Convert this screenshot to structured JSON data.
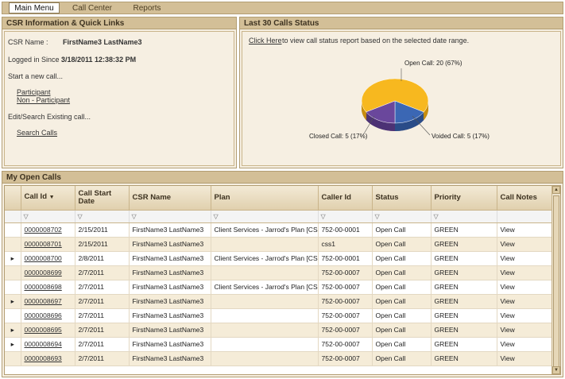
{
  "menu": {
    "items": [
      {
        "label": "Main Menu",
        "active": true
      },
      {
        "label": "Call Center",
        "active": false
      },
      {
        "label": "Reports",
        "active": false
      }
    ]
  },
  "csr_panel": {
    "title": "CSR Information & Quick Links",
    "csr_name_label": "CSR Name :",
    "csr_name_value": "FirstName3 LastName3",
    "logged_in_label": "Logged in Since :",
    "logged_in_value": "3/18/2011 12:38:32 PM",
    "start_new_call": "Start a new call...",
    "participant_link": "Participant",
    "non_participant_link": "Non - Participant",
    "edit_search_label": "Edit/Search Existing call...",
    "search_calls_link": "Search Calls"
  },
  "status_panel": {
    "title": "Last 30 Calls Status",
    "click_here": "Click Here",
    "description": " to view call status report based on the selected date range.",
    "colors": {
      "open": "#f7b81f",
      "closed": "#3b67b4",
      "voided": "#6a479c"
    }
  },
  "chart_data": {
    "type": "pie",
    "categories": [
      "Open Call",
      "Closed Call",
      "Voided Call"
    ],
    "values": [
      20,
      5,
      5
    ],
    "percents": [
      67,
      17,
      17
    ],
    "labels": [
      "Open Call: 20 (67%)",
      "Closed Call: 5 (17%)",
      "Voided Call: 5 (17%)"
    ]
  },
  "open_calls": {
    "title": "My Open Calls",
    "columns": [
      "Call Id",
      "Call Start Date",
      "CSR Name",
      "Plan",
      "Caller Id",
      "Status",
      "Priority",
      "Call Notes"
    ],
    "rows": [
      {
        "id": "0000008702",
        "date": "2/15/2011",
        "csr": "FirstName3 LastName3",
        "plan": "Client Services - Jarrod's Plan [CSS]",
        "caller": "752-00-0001",
        "status": "Open Call",
        "priority": "GREEN",
        "notes": "View",
        "expander": ""
      },
      {
        "id": "0000008701",
        "date": "2/15/2011",
        "csr": "FirstName3 LastName3",
        "plan": "",
        "caller": "css1",
        "status": "Open Call",
        "priority": "GREEN",
        "notes": "View",
        "expander": ""
      },
      {
        "id": "0000008700",
        "date": "2/8/2011",
        "csr": "FirstName3 LastName3",
        "plan": "Client Services - Jarrod's Plan [CSS]",
        "caller": "752-00-0001",
        "status": "Open Call",
        "priority": "GREEN",
        "notes": "View",
        "expander": "▸"
      },
      {
        "id": "0000008699",
        "date": "2/7/2011",
        "csr": "FirstName3 LastName3",
        "plan": "",
        "caller": "752-00-0007",
        "status": "Open Call",
        "priority": "GREEN",
        "notes": "View",
        "expander": ""
      },
      {
        "id": "0000008698",
        "date": "2/7/2011",
        "csr": "FirstName3 LastName3",
        "plan": "Client Services - Jarrod's Plan [CSS]",
        "caller": "752-00-0007",
        "status": "Open Call",
        "priority": "GREEN",
        "notes": "View",
        "expander": ""
      },
      {
        "id": "0000008697",
        "date": "2/7/2011",
        "csr": "FirstName3 LastName3",
        "plan": "",
        "caller": "752-00-0007",
        "status": "Open Call",
        "priority": "GREEN",
        "notes": "View",
        "expander": "▸"
      },
      {
        "id": "0000008696",
        "date": "2/7/2011",
        "csr": "FirstName3 LastName3",
        "plan": "",
        "caller": "752-00-0007",
        "status": "Open Call",
        "priority": "GREEN",
        "notes": "View",
        "expander": ""
      },
      {
        "id": "0000008695",
        "date": "2/7/2011",
        "csr": "FirstName3 LastName3",
        "plan": "",
        "caller": "752-00-0007",
        "status": "Open Call",
        "priority": "GREEN",
        "notes": "View",
        "expander": "▸"
      },
      {
        "id": "0000008694",
        "date": "2/7/2011",
        "csr": "FirstName3 LastName3",
        "plan": "",
        "caller": "752-00-0007",
        "status": "Open Call",
        "priority": "GREEN",
        "notes": "View",
        "expander": "▸"
      },
      {
        "id": "0000008693",
        "date": "2/7/2011",
        "csr": "FirstName3 LastName3",
        "plan": "",
        "caller": "752-00-0007",
        "status": "Open Call",
        "priority": "GREEN",
        "notes": "View",
        "expander": ""
      }
    ]
  }
}
